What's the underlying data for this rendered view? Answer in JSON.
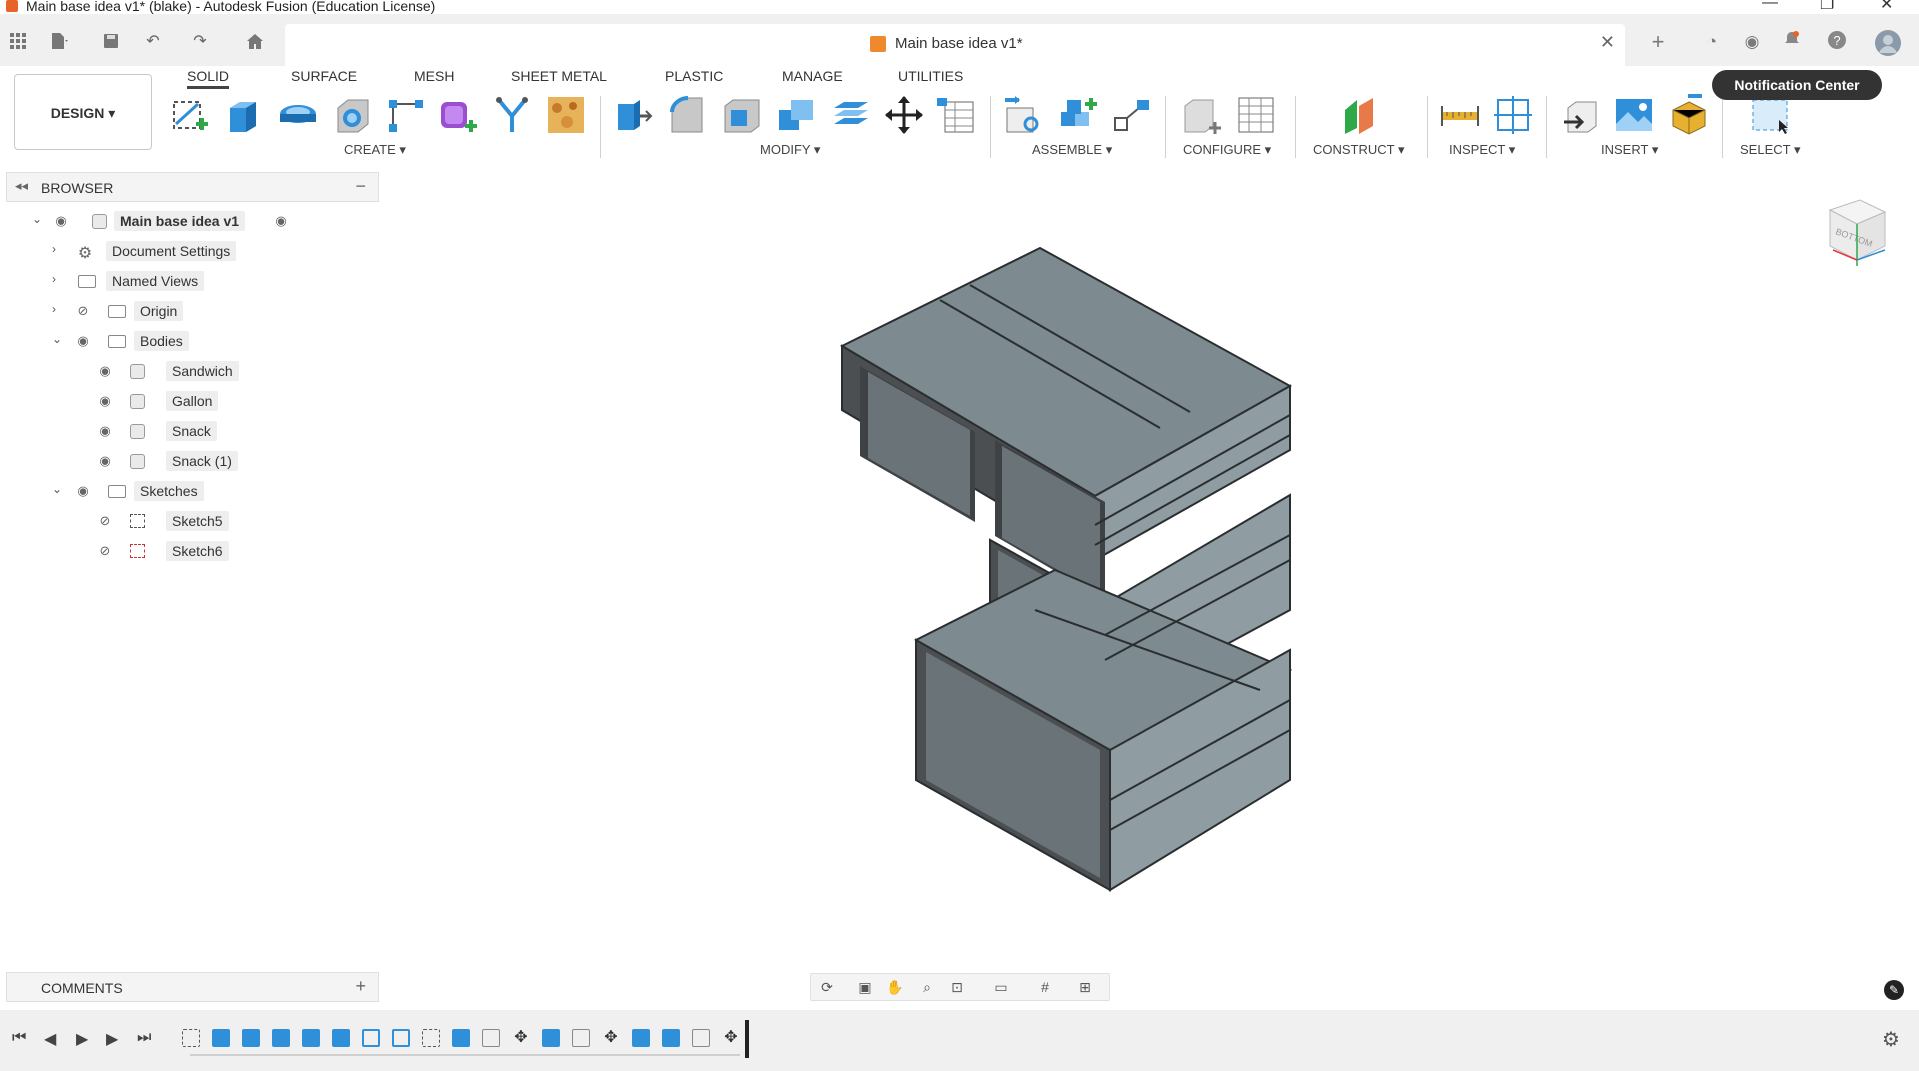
{
  "window": {
    "title": "Main base idea v1* (blake) - Autodesk Fusion (Education License)",
    "minimize": "—",
    "restore": "❐",
    "close": "✕"
  },
  "document_tab": {
    "title": "Main base idea v1*",
    "close": "✕"
  },
  "quick_access": {
    "icons": [
      "grid-icon",
      "file-icon",
      "save-icon",
      "undo-icon",
      "redo-icon",
      "home-icon"
    ]
  },
  "right_icons": [
    "plus-icon",
    "online-icon",
    "job-status-icon",
    "notification-bell-icon",
    "help-icon",
    "avatar"
  ],
  "workspace": {
    "label": "DESIGN ▾"
  },
  "ribbon": {
    "tabs": [
      "SOLID",
      "SURFACE",
      "MESH",
      "SHEET METAL",
      "PLASTIC",
      "MANAGE",
      "UTILITIES"
    ],
    "active_tab": "SOLID",
    "groups": [
      "CREATE ▾",
      "MODIFY ▾",
      "ASSEMBLE ▾",
      "CONFIGURE ▾",
      "CONSTRUCT ▾",
      "INSPECT ▾",
      "INSERT ▾",
      "SELECT ▾"
    ]
  },
  "tooltip": {
    "text": "Notification Center"
  },
  "browser": {
    "title": "BROWSER",
    "root": "Main base idea v1",
    "items": [
      {
        "label": "Document Settings"
      },
      {
        "label": "Named Views"
      },
      {
        "label": "Origin"
      },
      {
        "label": "Bodies"
      },
      {
        "label": "Sandwich"
      },
      {
        "label": "Gallon"
      },
      {
        "label": "Snack"
      },
      {
        "label": "Snack (1)"
      },
      {
        "label": "Sketches"
      },
      {
        "label": "Sketch5"
      },
      {
        "label": "Sketch6"
      }
    ]
  },
  "comments": {
    "title": "COMMENTS",
    "plus": "+"
  },
  "colors": {
    "model_face_top": "#7d8a90",
    "model_face_side": "#8f9ca1",
    "model_face_front": "#4b4f52",
    "accent_blue": "#2f8fd8",
    "accent_orange": "#f0892d"
  }
}
